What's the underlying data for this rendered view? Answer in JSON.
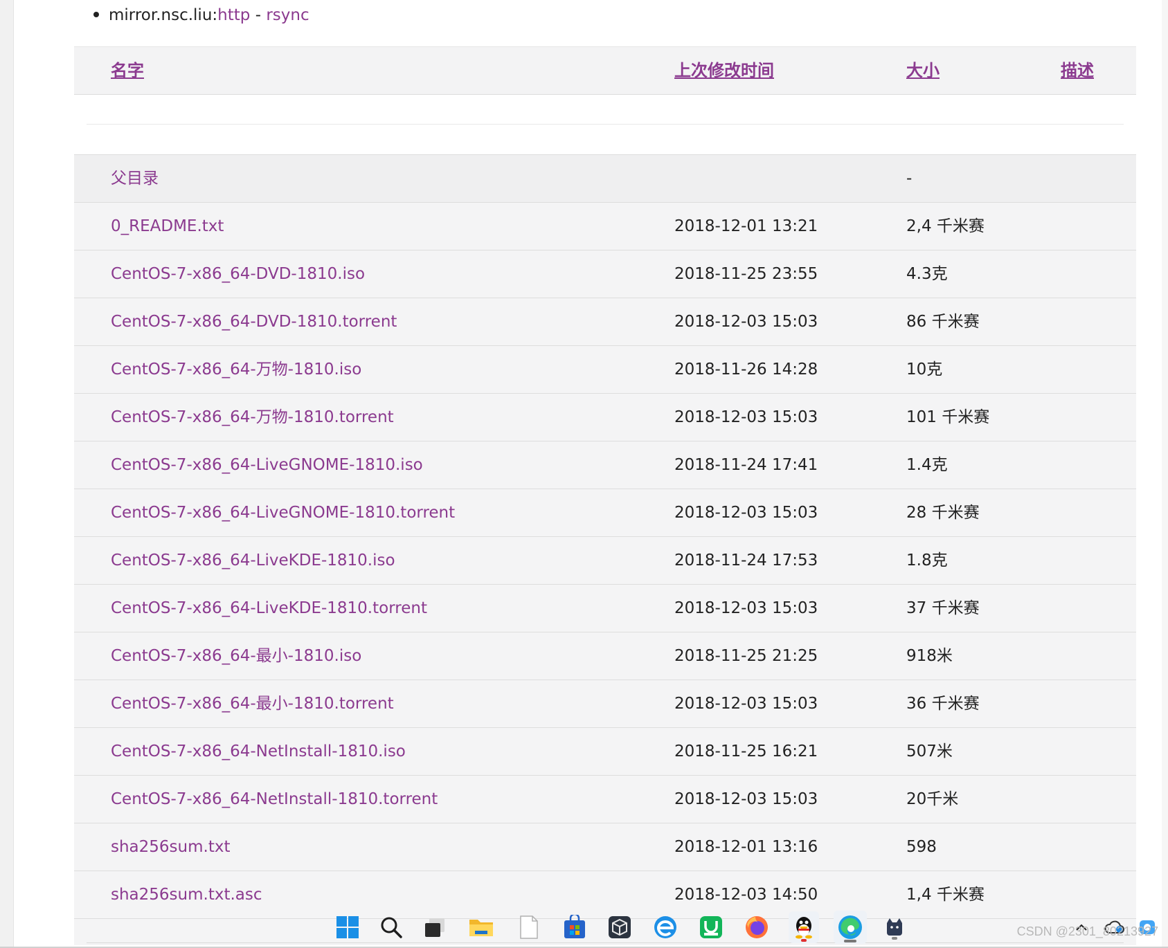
{
  "mirror": {
    "host": "mirror.nsc.liu:",
    "http_label": "http",
    "separator": "-",
    "rsync_label": "rsync"
  },
  "table": {
    "headers": {
      "name": "名字",
      "modified": "上次修改时间",
      "size": "大小",
      "description": "描述"
    },
    "parent": {
      "name": "父目录",
      "size": "-"
    },
    "rows": [
      {
        "name": "0_README.txt",
        "modified": "2018-12-01 13:21",
        "size": "2,4 千米赛"
      },
      {
        "name": "CentOS-7-x86_64-DVD-1810.iso",
        "modified": "2018-11-25 23:55",
        "size": "4.3克"
      },
      {
        "name": "CentOS-7-x86_64-DVD-1810.torrent",
        "modified": "2018-12-03 15:03",
        "size": "86 千米赛"
      },
      {
        "name": "CentOS-7-x86_64-万物-1810.iso",
        "modified": "2018-11-26 14:28",
        "size": "10克"
      },
      {
        "name": "CentOS-7-x86_64-万物-1810.torrent",
        "modified": "2018-12-03 15:03",
        "size": "101 千米赛"
      },
      {
        "name": "CentOS-7-x86_64-LiveGNOME-1810.iso",
        "modified": "2018-11-24 17:41",
        "size": "1.4克"
      },
      {
        "name": "CentOS-7-x86_64-LiveGNOME-1810.torrent",
        "modified": "2018-12-03 15:03",
        "size": "28 千米赛"
      },
      {
        "name": "CentOS-7-x86_64-LiveKDE-1810.iso",
        "modified": "2018-11-24 17:53",
        "size": "1.8克"
      },
      {
        "name": "CentOS-7-x86_64-LiveKDE-1810.torrent",
        "modified": "2018-12-03 15:03",
        "size": "37 千米赛"
      },
      {
        "name": "CentOS-7-x86_64-最小-1810.iso",
        "modified": "2018-11-25 21:25",
        "size": "918米"
      },
      {
        "name": "CentOS-7-x86_64-最小-1810.torrent",
        "modified": "2018-12-03 15:03",
        "size": "36 千米赛"
      },
      {
        "name": "CentOS-7-x86_64-NetInstall-1810.iso",
        "modified": "2018-11-25 16:21",
        "size": "507米"
      },
      {
        "name": "CentOS-7-x86_64-NetInstall-1810.torrent",
        "modified": "2018-12-03 15:03",
        "size": "20千米"
      },
      {
        "name": "sha256sum.txt",
        "modified": "2018-12-01 13:16",
        "size": "598"
      },
      {
        "name": "sha256sum.txt.asc",
        "modified": "2018-12-03 14:50",
        "size": "1,4 千米赛"
      }
    ]
  },
  "taskbar": {
    "icons": [
      "windows-start-icon",
      "search-icon",
      "task-view-icon",
      "file-explorer-icon",
      "notepad-icon",
      "microsoft-store-icon",
      "virtualbox-icon",
      "edge-legacy-icon",
      "wechat-work-icon",
      "firefox-icon",
      "qq-icon",
      "edge-icon",
      "cat-app-icon"
    ]
  },
  "watermark": "CSDN @2301_80213927",
  "colors": {
    "link": "#8b3a8f",
    "row_bg": "#f4f4f5",
    "border": "#dddddd"
  }
}
